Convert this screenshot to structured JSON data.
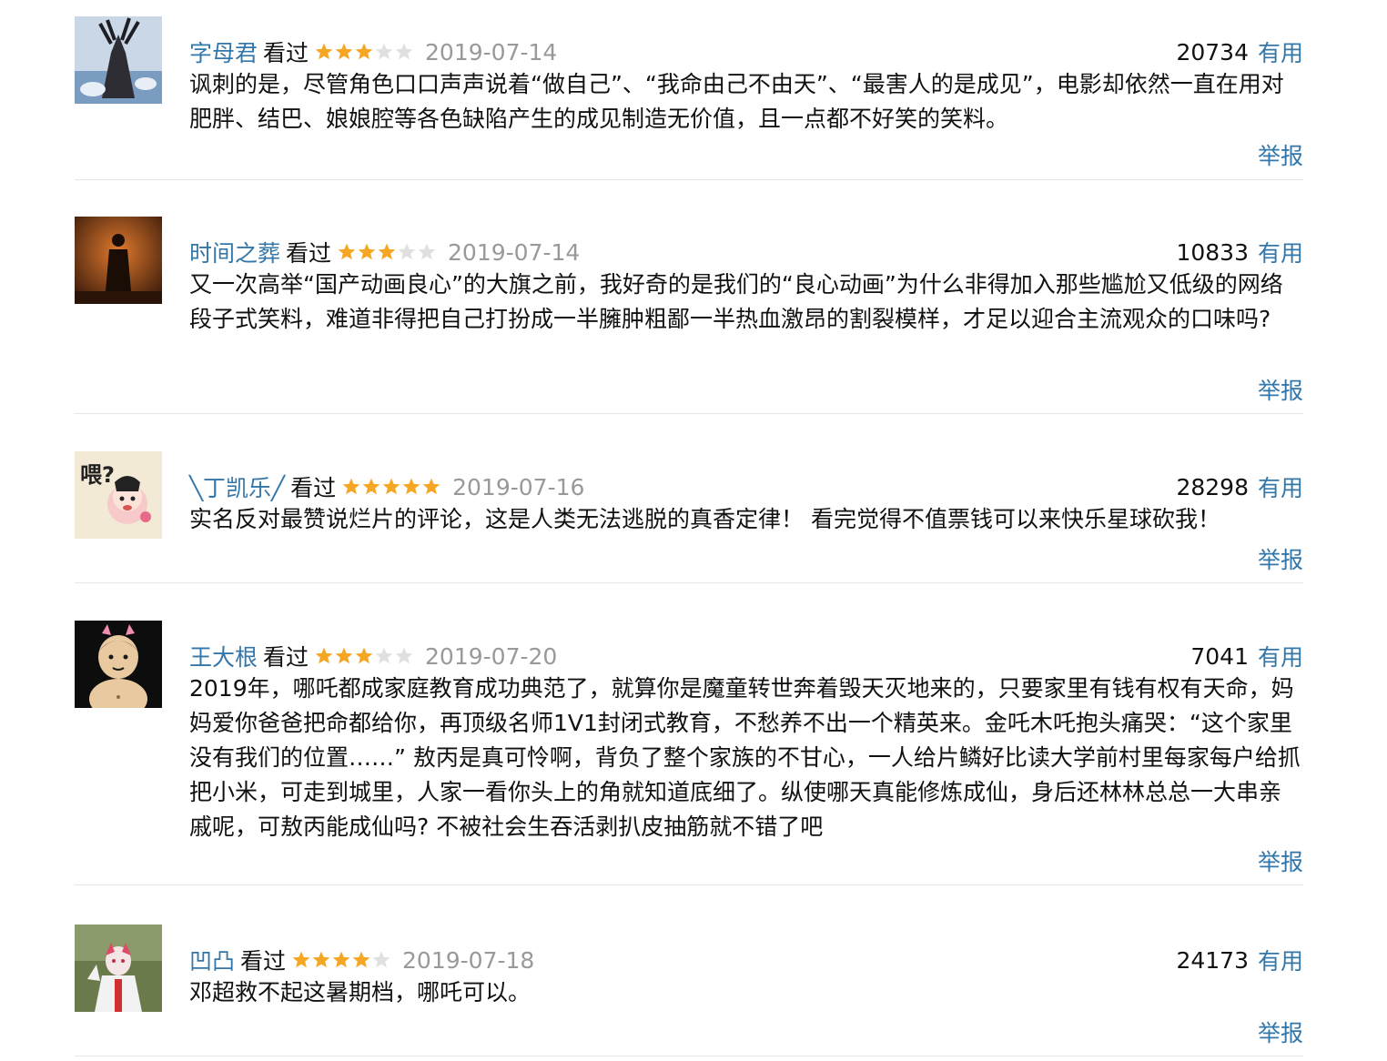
{
  "reviews": [
    {
      "author": "字母君",
      "status": "看过",
      "rating": 3,
      "date": "2019-07-14",
      "votes": "20734",
      "useful_label": "有用",
      "content": "讽刺的是，尽管角色口口声声说着“做自己”、“我命由己不由天”、“最害人的是成见”，电影却依然一直在用对肥胖、结巴、娘娘腔等各色缺陷产生的成见制造无价值，且一点都不好笑的笑料。",
      "report_label": "举报"
    },
    {
      "author": "时间之葬",
      "status": "看过",
      "rating": 3,
      "date": "2019-07-14",
      "votes": "10833",
      "useful_label": "有用",
      "content": "又一次高举“国产动画良心”的大旗之前，我好奇的是我们的“良心动画”为什么非得加入那些尴尬又低级的网络段子式笑料，难道非得把自己打扮成一半臃肿粗鄙一半热血激昂的割裂模样，才足以迎合主流观众的口味吗?",
      "report_label": "举报"
    },
    {
      "author": "╲丁凯乐╱",
      "status": "看过",
      "rating": 5,
      "date": "2019-07-16",
      "votes": "28298",
      "useful_label": "有用",
      "content": "实名反对最赞说烂片的评论，这是人类无法逃脱的真香定律！ 看完觉得不值票钱可以来快乐星球砍我！",
      "report_label": "举报"
    },
    {
      "author": "王大根",
      "status": "看过",
      "rating": 3,
      "date": "2019-07-20",
      "votes": "7041",
      "useful_label": "有用",
      "content": "2019年，哪吒都成家庭教育成功典范了，就算你是魔童转世奔着毁天灭地来的，只要家里有钱有权有天命，妈妈爱你爸爸把命都给你，再顶级名师1V1封闭式教育，不愁养不出一个精英来。金吒木吒抱头痛哭：“这个家里没有我们的位置……” 敖丙是真可怜啊，背负了整个家族的不甘心，一人给片鳞好比读大学前村里每家每户给抓把小米，可走到城里，人家一看你头上的角就知道底细了。纵使哪天真能修炼成仙，身后还林林总总一大串亲戚呢，可敖丙能成仙吗? 不被社会生吞活剥扒皮抽筋就不错了吧",
      "report_label": "举报"
    },
    {
      "author": "凹凸",
      "status": "看过",
      "rating": 4,
      "date": "2019-07-18",
      "votes": "24173",
      "useful_label": "有用",
      "content": "邓超救不起这暑期档，哪吒可以。",
      "report_label": "举报"
    }
  ],
  "colors": {
    "link": "#3377aa",
    "date": "#999999",
    "star_on": "#f5a623",
    "star_off": "#e0e0e0",
    "divider": "#e6e6e6"
  }
}
